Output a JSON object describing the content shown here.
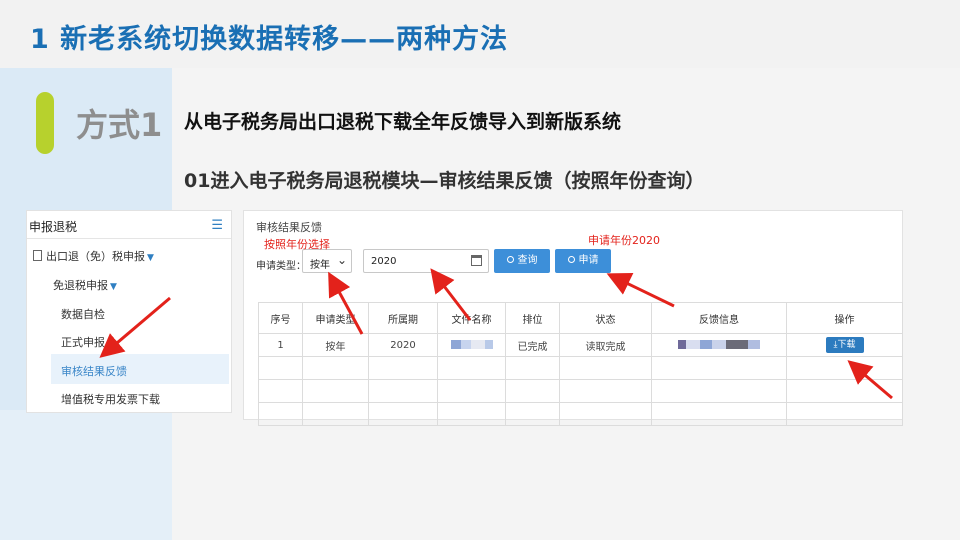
{
  "slide": {
    "title": "1 新老系统切换数据转移——两种方法",
    "method_label": "方式1",
    "heading1": "从电子税务局出口退税下载全年反馈导入到新版系统",
    "heading2": "01进入电子税务局退税模块—审核结果反馈（按照年份查询）"
  },
  "sidebar": {
    "header": "申报退税",
    "menu_icon": "hamburger-menu-icon",
    "items": [
      {
        "label": "出口退（免）税申报"
      },
      {
        "label": "免退税申报"
      },
      {
        "label": "数据自检"
      },
      {
        "label": "正式申报"
      },
      {
        "label": "审核结果反馈"
      },
      {
        "label": "增值税专用发票下载"
      }
    ]
  },
  "panel": {
    "title": "审核结果反馈",
    "type_label": "申请类型：",
    "type_value": "按年",
    "year_value": "2020",
    "query_button": "查询",
    "apply_button": "申请",
    "table": {
      "headers": [
        "序号",
        "申请类型",
        "所属期",
        "文件名称",
        "排位",
        "状态",
        "反馈信息",
        "操作"
      ],
      "rows": [
        {
          "index": "1",
          "type": "按年",
          "period": "2020",
          "rank": "已完成",
          "status": "读取完成",
          "action": "下载"
        }
      ]
    }
  },
  "annotations": {
    "by_year": "按照年份选择",
    "apply_2020": "申请年份2020"
  },
  "colors": {
    "title_blue": "#1a6fb4",
    "accent_green": "#b7d12d",
    "button_blue": "#3d8fd9",
    "annotation_red": "#e3221b"
  }
}
